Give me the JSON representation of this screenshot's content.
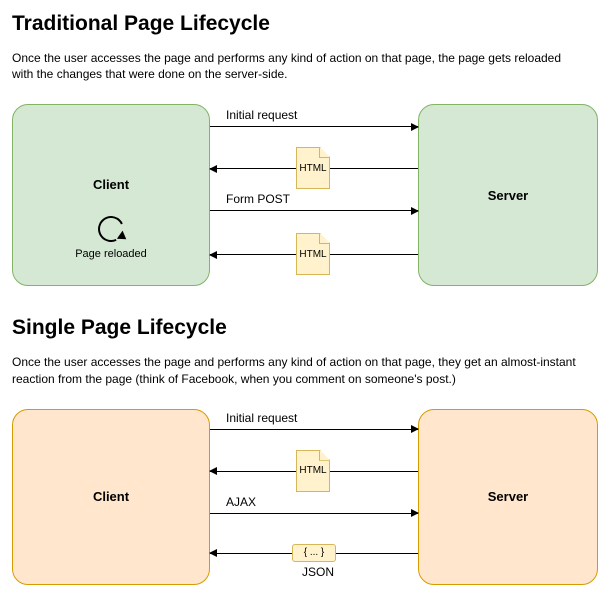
{
  "traditional": {
    "title": "Traditional Page Lifecycle",
    "description": "Once the user accesses the page and performs any kind of action on that page, the page gets reloaded with the changes that were done on the server-side.",
    "clientLabel": "Client",
    "serverLabel": "Server",
    "reloadLabel": "Page reloaded",
    "row1Label": "Initial request",
    "row2File": "HTML",
    "row3Label": "Form POST",
    "row4File": "HTML",
    "boxColor": "green"
  },
  "spa": {
    "title": "Single Page Lifecycle",
    "description": "Once the user accesses the page and performs any kind of action on that page, they get an almost-instant reaction from the page (think of Facebook, when you comment on someone's post.)",
    "clientLabel": "Client",
    "serverLabel": "Server",
    "row1Label": "Initial request",
    "row2File": "HTML",
    "row3Label": "AJAX",
    "row4Json": "{ ... }",
    "row4Caption": "JSON",
    "boxColor": "yellow"
  }
}
